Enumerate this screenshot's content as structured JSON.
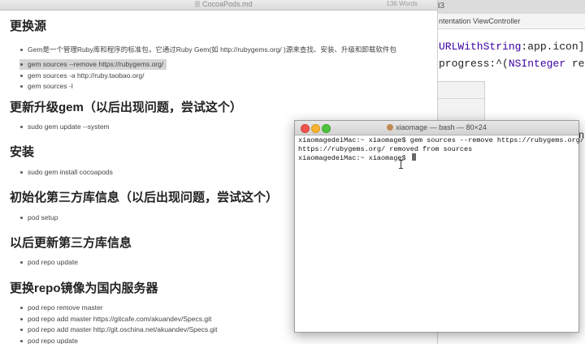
{
  "xcode": {
    "time_fragment": "33",
    "jump_bar": "ntentation ViewController",
    "code_lines": [
      {
        "pre": "",
        "kw": "URLWithString",
        "post": ":app.icon] pla"
      },
      {
        "pre": "progress:^(",
        "kw": "NSInteger",
        "post": " received"
      }
    ],
    "trailing_text": "neTy"
  },
  "doc": {
    "title": "CocoaPods.md",
    "word_count": "136 Words",
    "sections": [
      {
        "heading": "更换源",
        "items": [
          "Gem是一个管理Ruby库和程序的标准包，它通过Ruby Gem(如 http://rubygems.org/ )源来查找、安装、升级和卸载软件包",
          "gem sources --remove https://rubygems.org/",
          "gem sources -a http://ruby.taobao.org/",
          "gem sources -l"
        ]
      },
      {
        "heading": "更新升级gem（以后出现问题，尝试这个）",
        "items": [
          "sudo gem update --system"
        ]
      },
      {
        "heading": "安装",
        "items": [
          "sudo gem install cocoapods"
        ]
      },
      {
        "heading": "初始化第三方库信息（以后出现问题，尝试这个）",
        "items": [
          "pod setup"
        ]
      },
      {
        "heading": "以后更新第三方库信息",
        "items": [
          "pod repo update"
        ]
      },
      {
        "heading": "更换repo镜像为国内服务器",
        "items": [
          "pod repo remove master",
          "pod repo add master https://gitcafe.com/akuandev/Specs.git",
          "pod repo add master http://git.oschina.net/akuandev/Specs.git",
          "pod repo update"
        ]
      }
    ]
  },
  "terminal": {
    "title": "xiaomage — bash — 80×24",
    "lines": [
      "xiaomagedeiMac:~ xiaomage$ gem sources --remove https://rubygems.org/",
      "https://rubygems.org/ removed from sources",
      "xiaomagedeiMac:~ xiaomage$ "
    ]
  }
}
